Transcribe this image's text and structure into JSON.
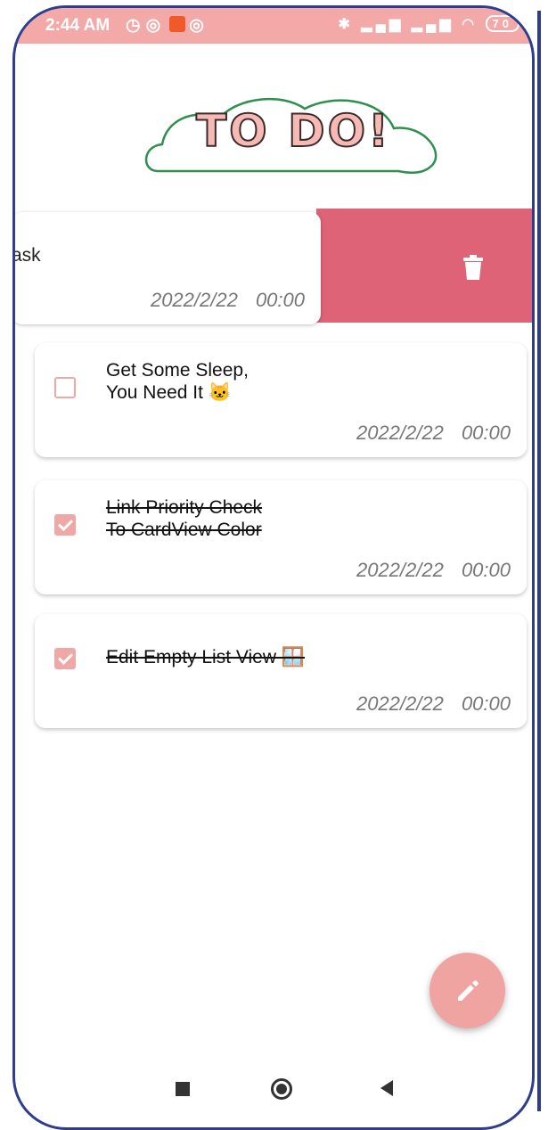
{
  "status_bar": {
    "time": "2:44 AM",
    "battery": "70"
  },
  "logo": {
    "text": "TO DO!"
  },
  "swiped_card": {
    "title": "ask",
    "date": "2022/2/22 00:00"
  },
  "tasks": [
    {
      "title": "Get Some Sleep,\nYou Need It 🐱",
      "date": "2022/2/22 00:00",
      "checked": false
    },
    {
      "title": "Link Priority Check\nTo CardView Color",
      "date": "2022/2/22 00:00",
      "checked": true
    },
    {
      "title": "Edit Empty List View 🪟",
      "date": "2022/2/22 00:00",
      "checked": true
    }
  ],
  "colors": {
    "status_bar": "#f3a9a7",
    "delete_bg": "#df6377",
    "accent": "#f0a8a6",
    "frame": "#2e3d8c"
  },
  "icons": {
    "delete": "trash-icon",
    "fab": "pencil-icon"
  }
}
